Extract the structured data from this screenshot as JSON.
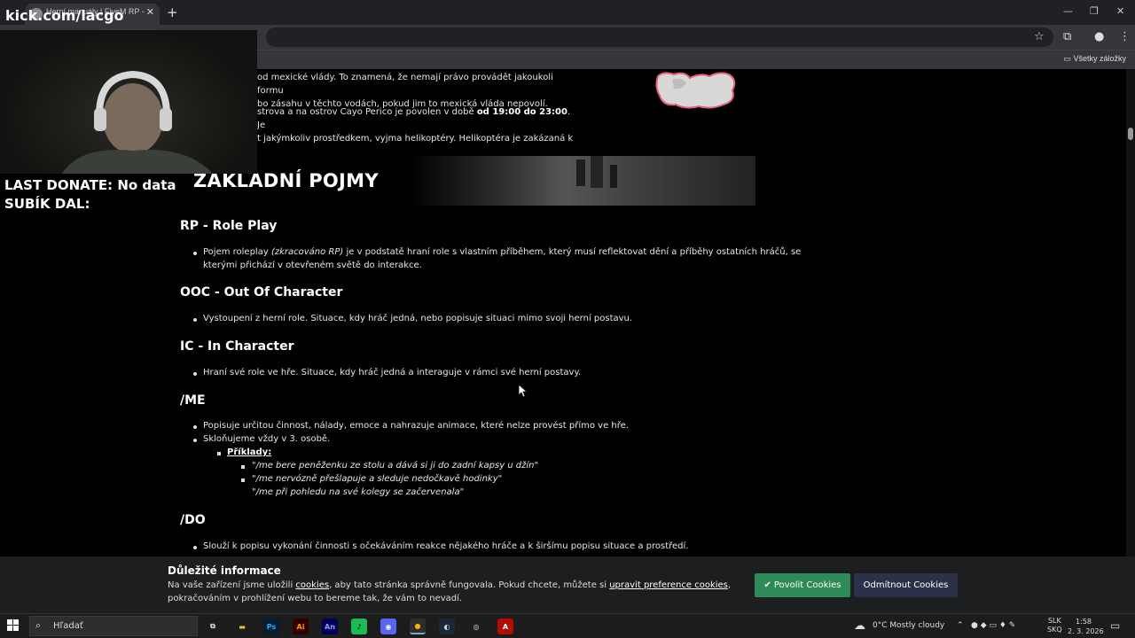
{
  "browser": {
    "tab_title": "Herní manuály | FiveM RP - Gen",
    "tab_close": "✕",
    "new_tab": "+",
    "bookmarks_all": "Všetky záložky",
    "window_controls": [
      "—",
      "❐",
      "✕"
    ]
  },
  "page": {
    "intro_lines": [
      "od mexické vlády. To znamená, že nemají právo provádět jakoukoli formu",
      "bo zásahu v těchto vodách, pokud jim to mexická vláda nepovolí."
    ],
    "cayo_line1_a": "strova a na ostrov Cayo Perico je povolen v době ",
    "cayo_line1_b": "od 19:00 do 23:00",
    "cayo_line1_c": ". Je",
    "cayo_line2": "t jakýmkoliv prostředkem, vyjma helikoptéry. Helikoptéra je zakázaná k",
    "heading": "ZAKLADNÍ POJMY",
    "sections": {
      "rp": {
        "title": "RP - Role Play",
        "item_a": "Pojem roleplay ",
        "item_b": "(zkracováno RP)",
        "item_c": " je v podstatě hraní role s vlastním příběhem, který musí reflektovat dění a příběhy ostatních hráčů, se",
        "item_line2": "kterými přichází v otevřeném světě do interakce."
      },
      "ooc": {
        "title": "OOC - Out Of Character",
        "item": "Vystoupení z herní role. Situace, kdy hráč jedná, nebo popisuje situaci mimo svoji herní postavu."
      },
      "ic": {
        "title": "IC - In Character",
        "item": "Hraní své role ve hře. Situace, kdy hráč jedná a interaguje v rámci své herní postavy."
      },
      "me": {
        "title": "/ME",
        "item1": "Popisuje určitou činnost, nálady, emoce a nahrazuje animace, které nelze provést přímo ve hře.",
        "item2": "Skloňujeme vždy v 3. osobě.",
        "examples_label": "Příklady:",
        "examples": [
          "\"/me bere peněženku ze stolu a dává si ji do zadní kapsy u džín\"",
          "\"/me nervózně přešlapuje a sleduje nedočkavě hodinky\"",
          "\"/me při pohledu na své kolegy se začervenala\""
        ]
      },
      "do": {
        "title": "/DO",
        "item": "Slouží k popisu vykonání činnosti s očekáváním reakce nějakého hráče a k širšímu popisu situace a prostředí."
      }
    }
  },
  "cookie": {
    "title": "Důležité informace",
    "text_a": "Na vaše zařízení jsme uložili ",
    "link_cookies": "cookies",
    "text_b": ", aby tato stránka správně fungovala. Pokud chcete, můžete si ",
    "link_prefs": "upravit preference cookies",
    "text_c": ",",
    "text_line2": "pokračováním v prohlížení webu to bereme tak, že vám to nevadí.",
    "allow_label": "Povolit Cookies",
    "deny_label": "Odmítnout Cookies"
  },
  "overlay": {
    "kick": "kick.com/lacgo",
    "donate_line1": "LAST DONATE: No data",
    "donate_line2": "SUBÍK DAL:"
  },
  "taskbar": {
    "search_placeholder": "Hľadať",
    "weather": "0°C  Mostly cloudy",
    "lang_top": "SLK",
    "lang_bottom": "SKQ",
    "time": "1:58",
    "date": "2. 3. 2026",
    "apps": [
      {
        "name": "task-view",
        "label": "⧉",
        "bg": "#1c1c1c",
        "fg": "#ddd"
      },
      {
        "name": "file-explorer",
        "label": "▬",
        "bg": "#1c1c1c",
        "fg": "#f2c230"
      },
      {
        "name": "photoshop",
        "label": "Ps",
        "bg": "#001e36",
        "fg": "#31a8ff"
      },
      {
        "name": "illustrator",
        "label": "Ai",
        "bg": "#330000",
        "fg": "#ff9a00"
      },
      {
        "name": "animate",
        "label": "An",
        "bg": "#00005b",
        "fg": "#9999ff"
      },
      {
        "name": "spotify",
        "label": "♪",
        "bg": "#1db954",
        "fg": "#000"
      },
      {
        "name": "discord",
        "label": "◉",
        "bg": "#5865f2",
        "fg": "#fff"
      },
      {
        "name": "chrome",
        "label": "●",
        "bg": "#2d2d2d",
        "fg": "#f4b400"
      },
      {
        "name": "steam",
        "label": "◐",
        "bg": "#1b2838",
        "fg": "#c7d5e0"
      },
      {
        "name": "obs",
        "label": "◎",
        "bg": "#1c1c1c",
        "fg": "#ddd"
      },
      {
        "name": "acrobat",
        "label": "A",
        "bg": "#b30b00",
        "fg": "#fff"
      }
    ]
  },
  "colors": {
    "accent_green": "#2e8b57",
    "accent_navy": "#2b3149",
    "page_bg": "#000000"
  }
}
